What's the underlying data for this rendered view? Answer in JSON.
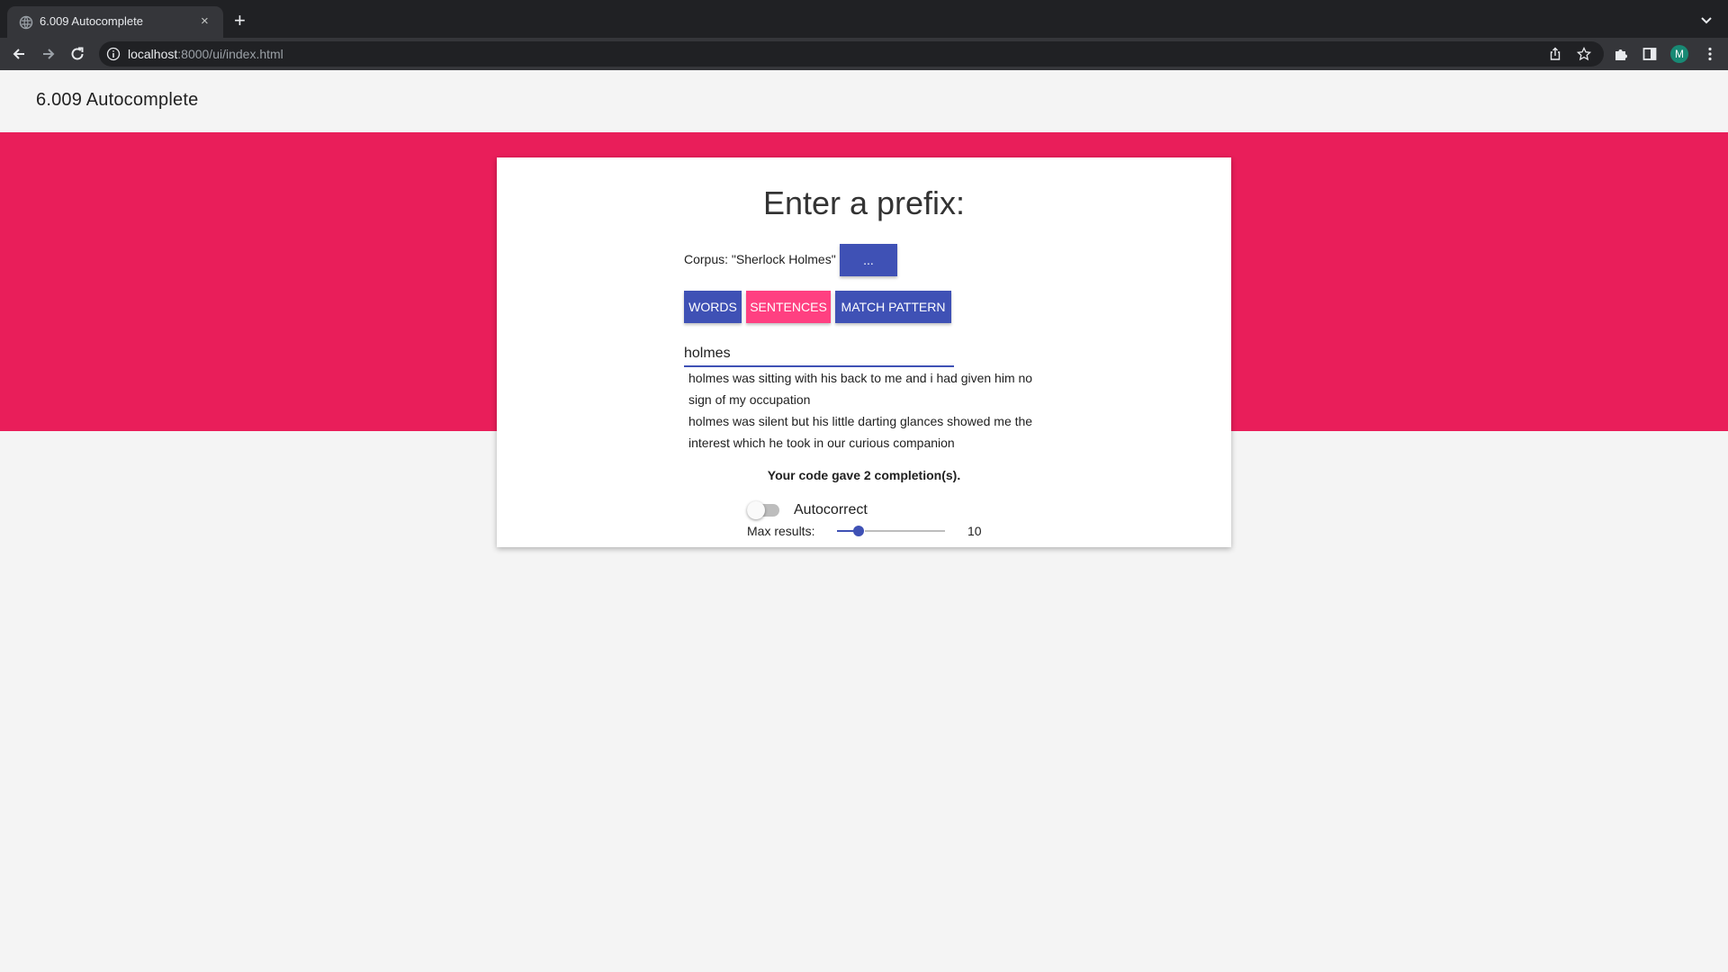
{
  "browser": {
    "tab_title": "6.009 Autocomplete",
    "tab_close": "×",
    "new_tab": "+",
    "url_host": "localhost",
    "url_rest": ":8000/ui/index.html",
    "profile_initial": "M",
    "icons": [
      "globe-icon",
      "close-icon",
      "plus-icon",
      "chevron-down-icon",
      "back-arrow-icon",
      "forward-arrow-icon",
      "reload-icon",
      "info-icon",
      "share-icon",
      "star-icon",
      "puzzle-icon",
      "side-panel-icon",
      "kebab-menu-icon"
    ]
  },
  "app": {
    "title": "6.009 Autocomplete"
  },
  "card": {
    "heading": "Enter a prefix:",
    "corpus_label": "Corpus: \"Sherlock Holmes\"",
    "corpus_button": "...",
    "modes": {
      "words": "WORDS",
      "sentences": "SENTENCES",
      "pattern": "MATCH PATTERN"
    },
    "active_mode": "sentences",
    "prefix_value": "holmes",
    "results": [
      "holmes was sitting with his back to me and i had given him no sign of my occupation",
      "holmes was silent but his little darting glances showed me the interest which he took in our curious companion"
    ],
    "count_message": "Your code gave 2 completion(s).",
    "autocorrect_label": "Autocorrect",
    "autocorrect_on": false,
    "max_results_label": "Max results:",
    "max_results_value": "10",
    "max_results_fraction": 0.2
  },
  "colors": {
    "primary": "#3f51b5",
    "accent": "#ff4081",
    "hero": "#e91e5a"
  }
}
